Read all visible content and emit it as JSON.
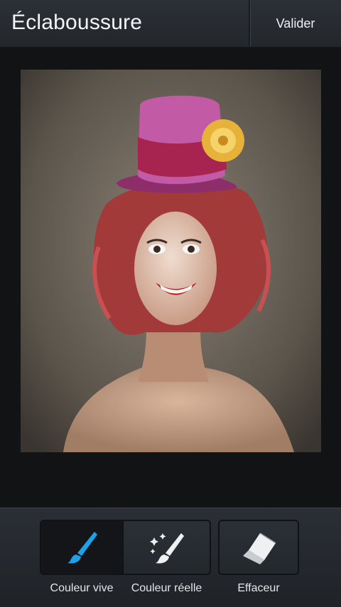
{
  "header": {
    "title": "Éclaboussure",
    "confirm_label": "Valider"
  },
  "canvas": {
    "image": "portrait-clown-woman-pink-top-hat-yellow-flower",
    "zoom_icon": "zoom-in-icon"
  },
  "tools": [
    {
      "label": "Couleur vive",
      "icon": "brush-icon",
      "active": true
    },
    {
      "label": "Couleur réelle",
      "icon": "magic-brush-icon",
      "active": false
    },
    {
      "label": "Effaceur",
      "icon": "eraser-icon",
      "active": false
    }
  ],
  "colors": {
    "accent": "#1ea1e6",
    "bar": "#2a2f35",
    "background": "#111315"
  }
}
